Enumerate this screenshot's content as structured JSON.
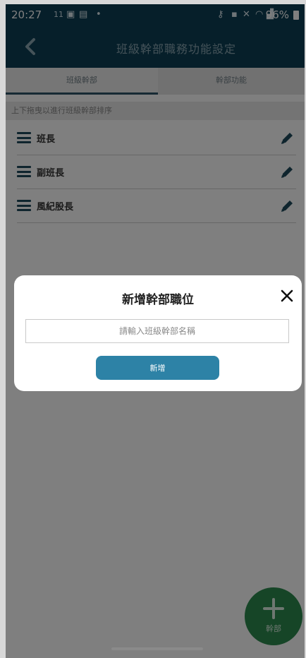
{
  "status_bar": {
    "time": "20:27",
    "date": "11",
    "battery": "96%"
  },
  "header": {
    "title": "班級幹部職務功能設定",
    "back_icon": "chevron-left-icon"
  },
  "tabs": [
    {
      "label": "班級幹部",
      "active": true
    },
    {
      "label": "幹部功能",
      "active": false
    }
  ],
  "hint": "上下拖曳以進行班級幹部排序",
  "list": {
    "items": [
      {
        "label": "班長"
      },
      {
        "label": "副班長"
      },
      {
        "label": "風紀股長"
      }
    ]
  },
  "fab": {
    "label": "幹部",
    "icon": "plus-icon"
  },
  "modal": {
    "title": "新增幹部職位",
    "input_value": "",
    "input_placeholder": "請輸入班級幹部名稱",
    "submit_label": "新增",
    "close_icon": "close-icon"
  },
  "colors": {
    "primary": "#0d3f54",
    "accent": "#2d82a6",
    "fab": "#2c8a4e"
  }
}
